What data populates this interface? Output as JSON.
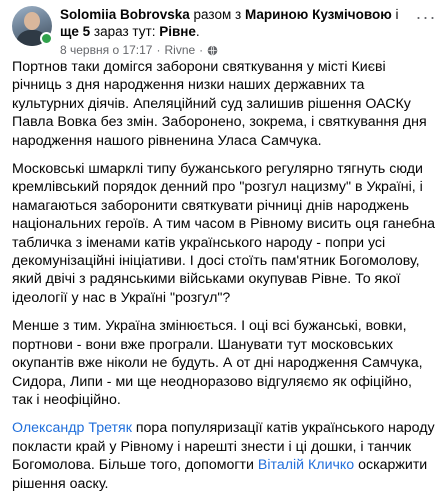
{
  "post": {
    "author": "Solomiia Bobrovska",
    "with_prefix": " разом з ",
    "tagged_person": "Мариною Кузмічовою",
    "tagged_suffix": " і",
    "others_label": "ще 5",
    "location_prefix": " зараз тут: ",
    "location": "Рівне",
    "location_suffix": ".",
    "date": "8 червня о 17:17",
    "meta_sep": "·",
    "meta_place": "Rivne",
    "meta_sep2": "·",
    "menu_label": "···",
    "icons": [
      "globe-icon",
      "more-options-icon",
      "online-status-dot"
    ],
    "paragraphs": {
      "p1": "Портнов таки домігся заборони святкування у місті Києві річниць з дня народження низки наших державних та культурних діячів. Апеляційний суд залишив рішення ОАСКу Павла Вовка без змін. Заборонено, зокрема, і святкування дня народження нашого рівненина Уласа Самчука.",
      "p2": "Московські шмарклі типу бужанського регулярно тягнуть сюди кремлівський порядок денний про \"розгул нацизму\" в Україні, і намагаються заборонити святкувати річниці днів народжень національних героїв. А тим часом в Рівному висить оця ганебна табличка з іменами катів українського народу - попри усі декомунізаційні ініціативи. І досі стоїть пам'ятник Богомолову, який двічі з радянськими військами окупував Рівне. То якої ідеології у нас в Україні \"розгул\"?",
      "p3": "Менше з тим. Україна змінюється. І оці всі бужанські, вовки, портнови - вони вже програли. Шанувати тут московських окупантів вже ніколи не будуть. А от дні народження Самчука, Сидора, Липи - ми ще неодноразово відгуляємо як офіційно, так і неофіційно.",
      "p4_mention1": "Олександр Третяк",
      "p4_text1": " пора популяризації катів українського народу покласти край у Рівному і нарешті знести і ці дошки, і танчик Богомолова. Більше того, допомогти ",
      "p4_mention2": "Віталій Кличко",
      "p4_text2": " оскаржити рішення оаску."
    }
  }
}
